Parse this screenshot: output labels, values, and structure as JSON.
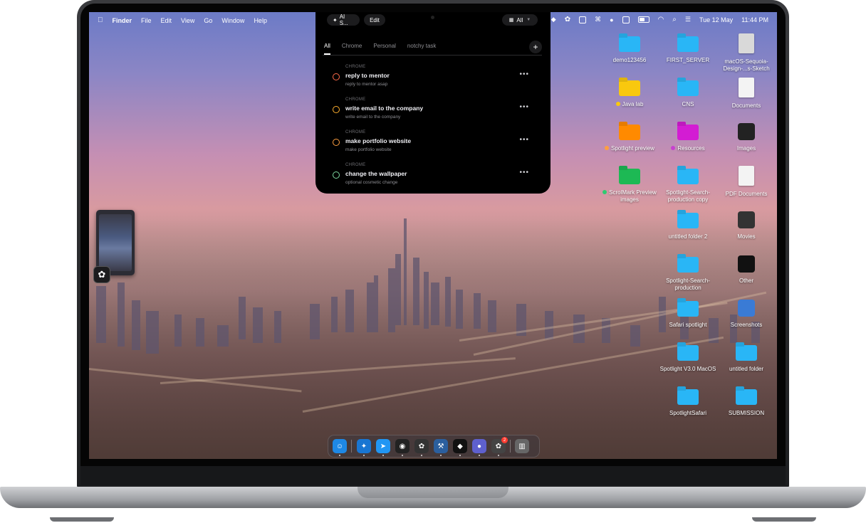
{
  "menubar": {
    "apple": "",
    "app": "Finder",
    "items": [
      "File",
      "Edit",
      "View",
      "Go",
      "Window",
      "Help"
    ],
    "date": "Tue 12 May",
    "time": "11:44 PM"
  },
  "notch_panel": {
    "ai_pill": "AI S...",
    "edit_pill": "Edit",
    "filter_pill": "All",
    "tabs": [
      "All",
      "Chrome",
      "Personal",
      "notchy task"
    ],
    "add_symbol": "+",
    "tasks": [
      {
        "source": "CHROME",
        "title": "reply to mentor",
        "subtitle": "reply to mentor asap",
        "color": "#ff6b4a"
      },
      {
        "source": "CHROME",
        "title": "write email to the company",
        "subtitle": "write email to the company",
        "color": "#ffb02e"
      },
      {
        "source": "CHROME",
        "title": "make portfolio website",
        "subtitle": "make portfolio website",
        "color": "#ff9f40"
      },
      {
        "source": "CHROME",
        "title": "change the wallpaper",
        "subtitle": "optional cosmetic change",
        "color": "#7ed9a0"
      }
    ],
    "more_symbol": "•••"
  },
  "desktop": {
    "col1": [
      {
        "label": "demo123456",
        "kind": "folder",
        "color": "#29b6f6"
      },
      {
        "label": "Java lab",
        "kind": "folder",
        "color": "#f9c80e",
        "tag": "#f9c80e"
      },
      {
        "label": "Spotlight preview",
        "kind": "folder",
        "color": "#ff8a00",
        "tag": "#ffa040"
      },
      {
        "label": "ScrolMark Preview images",
        "kind": "folder",
        "color": "#1db954",
        "tag": "#2ecc71"
      }
    ],
    "col2": [
      {
        "label": "FIRST_SERVER",
        "kind": "folder",
        "color": "#29b6f6"
      },
      {
        "label": "CNS",
        "kind": "folder",
        "color": "#29b6f6"
      },
      {
        "label": "Resources",
        "kind": "folder",
        "color": "#d31cd3",
        "tag": "#c740d0"
      },
      {
        "label": "Spotlight-Search-production copy",
        "kind": "folder",
        "color": "#29b6f6"
      },
      {
        "label": "untitled folder 2",
        "kind": "folder",
        "color": "#29b6f6"
      },
      {
        "label": "Spotlight-Search-production",
        "kind": "folder",
        "color": "#29b6f6"
      },
      {
        "label": "Safari spotlight",
        "kind": "folder",
        "color": "#29b6f6"
      },
      {
        "label": "Spotlight V3.0 MacOS",
        "kind": "folder",
        "color": "#29b6f6"
      },
      {
        "label": "SpotlightSafari",
        "kind": "folder",
        "color": "#29b6f6"
      }
    ],
    "col3": [
      {
        "label": "macOS-Sequoia-Design-...s-Sketch",
        "kind": "file"
      },
      {
        "label": "Documents",
        "kind": "doc"
      },
      {
        "label": "Images",
        "kind": "thumb",
        "color": "#222"
      },
      {
        "label": "PDF Documents",
        "kind": "doc"
      },
      {
        "label": "Movies",
        "kind": "thumb",
        "color": "#333"
      },
      {
        "label": "Other",
        "kind": "thumb",
        "color": "#111"
      },
      {
        "label": "Screenshots",
        "kind": "thumb",
        "color": "#3a7bd5"
      },
      {
        "label": "untitled folder",
        "kind": "folder",
        "color": "#29b6f6"
      },
      {
        "label": "SUBMISSION",
        "kind": "folder",
        "color": "#29b6f6"
      }
    ]
  },
  "dock": {
    "badge_count": "2",
    "apps": [
      {
        "name": "finder-app",
        "color": "#1e88e5",
        "glyph": "☺"
      },
      {
        "name": "safari-app",
        "color": "#1976d2",
        "glyph": "✦"
      },
      {
        "name": "telegram-app",
        "color": "#2196f3",
        "glyph": "➤"
      },
      {
        "name": "github-app",
        "color": "#222",
        "glyph": "◉"
      },
      {
        "name": "chatgpt-app",
        "color": "#333",
        "glyph": "✿"
      },
      {
        "name": "xcode-app",
        "color": "#2b5f9e",
        "glyph": "⚒"
      },
      {
        "name": "figma-app",
        "color": "#111",
        "glyph": "◆"
      },
      {
        "name": "proton-app",
        "color": "#5e60ce",
        "glyph": "●"
      },
      {
        "name": "openai-app",
        "color": "#444",
        "glyph": "✿"
      },
      {
        "name": "trash-app",
        "color": "#666",
        "glyph": "▥"
      }
    ]
  }
}
